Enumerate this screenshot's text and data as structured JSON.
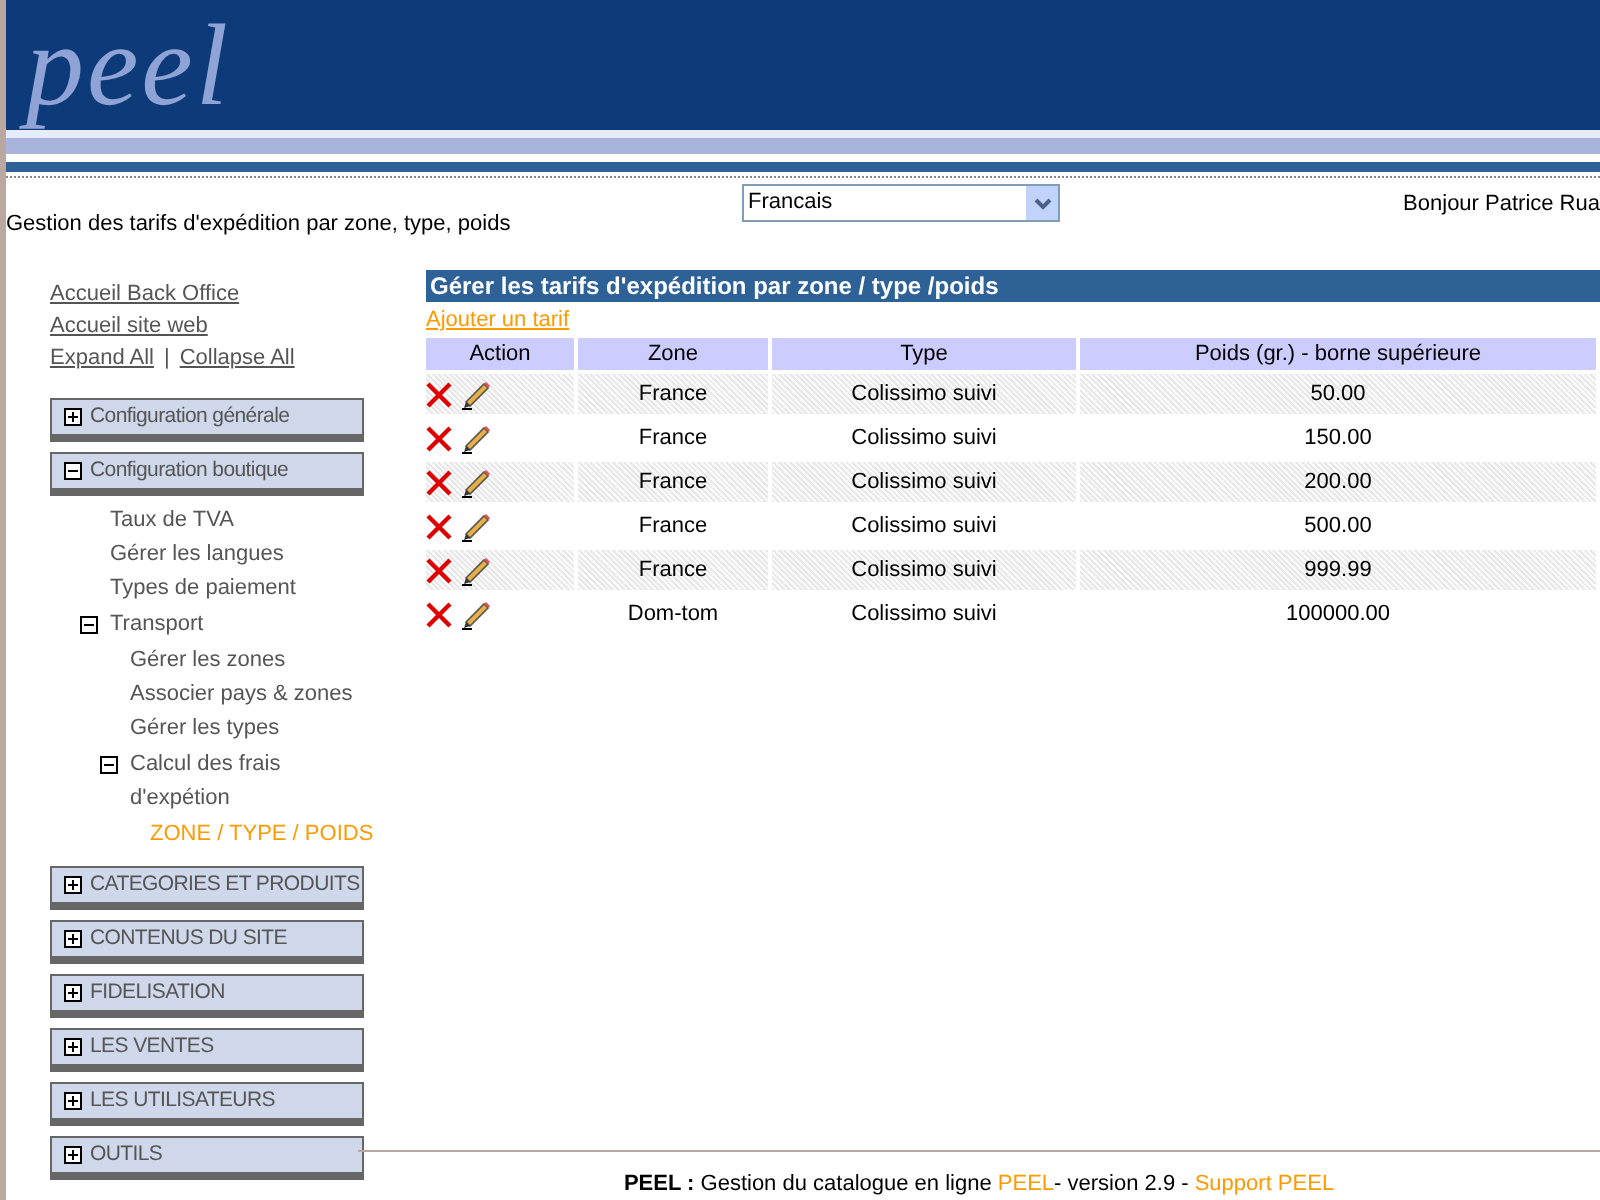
{
  "logo": "peel",
  "page_title": "Gestion des tarifs d'expédition par zone, type, poids",
  "language_select": {
    "value": "Francais"
  },
  "greeting": "Bonjour Patrice Rua",
  "sidebar": {
    "links": [
      "Accueil Back Office",
      "Accueil site web"
    ],
    "expand_all": "Expand All",
    "separator": "|",
    "collapse_all": "Collapse All",
    "sections": [
      {
        "label": "Configuration générale",
        "expanded": false
      },
      {
        "label": "Configuration boutique",
        "expanded": true,
        "children": [
          {
            "label": "Taux de TVA",
            "selected": false
          },
          {
            "label": "Gérer les langues",
            "selected": false
          },
          {
            "label": "Types de paiement",
            "selected": false
          },
          {
            "label": "Transport",
            "expanded": true,
            "children": [
              {
                "label": "Gérer les zones",
                "selected": false
              },
              {
                "label": "Associer pays & zones",
                "selected": false
              },
              {
                "label": "Gérer les types",
                "selected": false
              },
              {
                "label": "Calcul des frais d'expétion",
                "expanded": true,
                "children": [
                  {
                    "label": "ZONE / TYPE / POIDS",
                    "selected": true
                  }
                ]
              }
            ]
          }
        ]
      },
      {
        "label": "CATEGORIES ET PRODUITS",
        "expanded": false
      },
      {
        "label": "CONTENUS DU SITE",
        "expanded": false
      },
      {
        "label": "FIDELISATION",
        "expanded": false
      },
      {
        "label": "LES VENTES",
        "expanded": false
      },
      {
        "label": "LES UTILISATEURS",
        "expanded": false
      },
      {
        "label": "OUTILS",
        "expanded": false
      }
    ]
  },
  "panel": {
    "title": "Gérer les tarifs d'expédition par zone / type /poids",
    "add_link": "Ajouter un tarif",
    "table": {
      "columns": [
        "Action",
        "Zone",
        "Type",
        "Poids (gr.) - borne supérieure"
      ],
      "rows": [
        {
          "zone": "France",
          "type": "Colissimo suivi",
          "weight": "50.00"
        },
        {
          "zone": "France",
          "type": "Colissimo suivi",
          "weight": "150.00"
        },
        {
          "zone": "France",
          "type": "Colissimo suivi",
          "weight": "200.00"
        },
        {
          "zone": "France",
          "type": "Colissimo suivi",
          "weight": "500.00"
        },
        {
          "zone": "France",
          "type": "Colissimo suivi",
          "weight": "999.99"
        },
        {
          "zone": "Dom-tom",
          "type": "Colissimo suivi",
          "weight": "100000.00"
        }
      ]
    }
  },
  "footer": {
    "brand": "PEEL :",
    "text": "Gestion du catalogue en ligne",
    "link": "PEEL",
    "version": "- version 2.9 -",
    "support_link": "Support PEEL"
  }
}
